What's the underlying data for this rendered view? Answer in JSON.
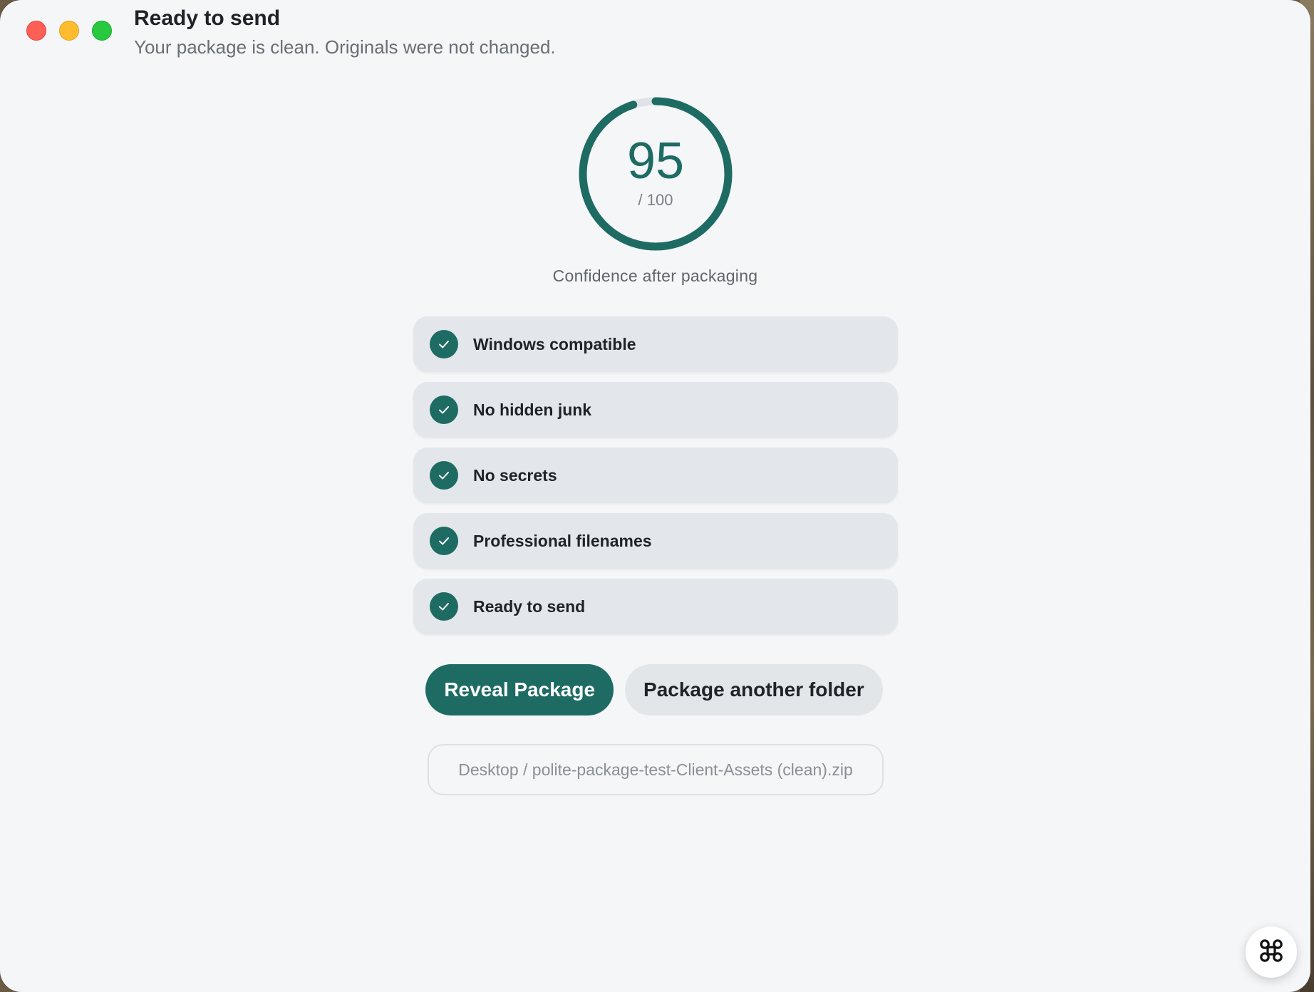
{
  "window": {
    "title": "Ready to send",
    "subtitle": "Your package is clean. Originals were not changed."
  },
  "score": {
    "value": "95",
    "max_label": "/ 100",
    "progress_fraction": 0.95,
    "caption": "Confidence after packaging",
    "accent_color": "#1e6b63"
  },
  "checks": [
    {
      "label": "Windows compatible",
      "status": "passed"
    },
    {
      "label": "No hidden junk",
      "status": "passed"
    },
    {
      "label": "No secrets",
      "status": "passed"
    },
    {
      "label": "Professional filenames",
      "status": "passed"
    },
    {
      "label": "Ready to send",
      "status": "passed"
    }
  ],
  "actions": {
    "primary_label": "Reveal Package",
    "secondary_label": "Package another folder"
  },
  "output_path": "Desktop / polite-package-test-Client-Assets (clean).zip",
  "icons": {
    "check": "check-icon",
    "fab": "command-icon"
  }
}
